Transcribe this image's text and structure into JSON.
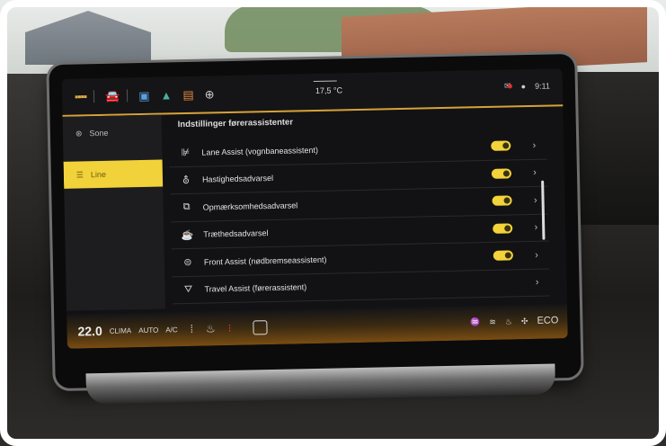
{
  "topbar": {
    "temperature": "17,5 °C",
    "time": "9:11"
  },
  "sidebar": {
    "items": [
      {
        "label": "Sone",
        "icon": "steering-wheel-icon",
        "active": false
      },
      {
        "label": "Line",
        "icon": "lines-icon",
        "active": true
      }
    ]
  },
  "main": {
    "title": "Indstillinger førerassistenter",
    "rows": [
      {
        "label": "Lane Assist (vognbaneassistent)",
        "icon": "lane-assist-icon",
        "toggle": true
      },
      {
        "label": "Hastighedsadvarsel",
        "icon": "speed-warning-icon",
        "toggle": true
      },
      {
        "label": "Opmærksomhedsadvarsel",
        "icon": "attention-warning-icon",
        "toggle": true
      },
      {
        "label": "Trætheds­advarsel",
        "icon": "fatigue-warning-icon",
        "toggle": true
      },
      {
        "label": "Front Assist (nødbremseassistent)",
        "icon": "front-assist-icon",
        "toggle": true
      },
      {
        "label": "Travel Assist (førerassistent)",
        "icon": "travel-assist-icon",
        "toggle": false
      }
    ]
  },
  "climate": {
    "temperature": "22.0",
    "climate_label": "CLIMA",
    "auto_label": "AUTO",
    "ac_label": "A/C",
    "eco_label": "ECO"
  },
  "colors": {
    "accent": "#f2d23a",
    "topline": "#d6a23a",
    "bottomglow": "#7a4d12"
  }
}
